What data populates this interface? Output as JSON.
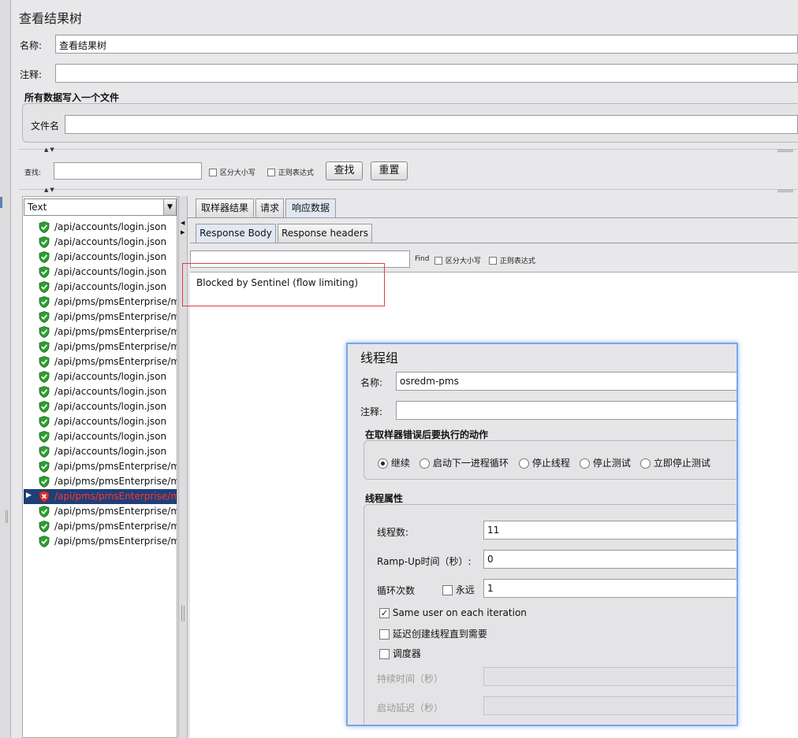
{
  "panel": {
    "title": "查看结果树",
    "name_label": "名称:",
    "name_value": "查看结果树",
    "comment_label": "注释:",
    "comment_value": "",
    "file_group_title": "所有数据写入一个文件",
    "file_label": "文件名",
    "file_value": ""
  },
  "search": {
    "label": "查找:",
    "value": "",
    "case_label": "区分大小写",
    "regex_label": "正则表达式",
    "find_button": "查找",
    "reset_button": "重置"
  },
  "renderer": {
    "selected": "Text"
  },
  "tree": {
    "items": [
      {
        "label": "/api/accounts/login.json",
        "status": "success"
      },
      {
        "label": "/api/accounts/login.json",
        "status": "success"
      },
      {
        "label": "/api/accounts/login.json",
        "status": "success"
      },
      {
        "label": "/api/accounts/login.json",
        "status": "success"
      },
      {
        "label": "/api/accounts/login.json",
        "status": "success"
      },
      {
        "label": "/api/pms/pmsEnterprise/myL",
        "status": "success"
      },
      {
        "label": "/api/pms/pmsEnterprise/myL",
        "status": "success"
      },
      {
        "label": "/api/pms/pmsEnterprise/myL",
        "status": "success"
      },
      {
        "label": "/api/pms/pmsEnterprise/myL",
        "status": "success"
      },
      {
        "label": "/api/pms/pmsEnterprise/myL",
        "status": "success"
      },
      {
        "label": "/api/accounts/login.json",
        "status": "success"
      },
      {
        "label": "/api/accounts/login.json",
        "status": "success"
      },
      {
        "label": "/api/accounts/login.json",
        "status": "success"
      },
      {
        "label": "/api/accounts/login.json",
        "status": "success"
      },
      {
        "label": "/api/accounts/login.json",
        "status": "success"
      },
      {
        "label": "/api/accounts/login.json",
        "status": "success"
      },
      {
        "label": "/api/pms/pmsEnterprise/myL",
        "status": "success"
      },
      {
        "label": "/api/pms/pmsEnterprise/myL",
        "status": "success"
      },
      {
        "label": "/api/pms/pmsEnterprise/myL",
        "status": "error",
        "selected": true
      },
      {
        "label": "/api/pms/pmsEnterprise/myL",
        "status": "success"
      },
      {
        "label": "/api/pms/pmsEnterprise/myL",
        "status": "success"
      },
      {
        "label": "/api/pms/pmsEnterprise/myL",
        "status": "success"
      }
    ]
  },
  "result_tabs": [
    "取样器结果",
    "请求",
    "响应数据"
  ],
  "response_tabs": [
    "Response Body",
    "Response headers"
  ],
  "response_search": {
    "find_label": "Find",
    "case_label": "区分大小写",
    "regex_label": "正则表达式"
  },
  "response_body": "Blocked by Sentinel (flow limiting)",
  "thread_group": {
    "title": "线程组",
    "name_label": "名称:",
    "name_value": "osredm-pms",
    "comment_label": "注释:",
    "comment_value": "",
    "error_action_title": "在取样器错误后要执行的动作",
    "actions": [
      "继续",
      "启动下一进程循环",
      "停止线程",
      "停止测试",
      "立即停止测试"
    ],
    "selected_action": "继续",
    "props_title": "线程属性",
    "threads_label": "线程数:",
    "threads_value": "11",
    "rampup_label": "Ramp-Up时间（秒）:",
    "rampup_value": "0",
    "loop_label": "循环次数",
    "forever_label": "永远",
    "loop_value": "1",
    "same_user_label": "Same user on each iteration",
    "delay_label": "延迟创建线程直到需要",
    "scheduler_label": "调度器",
    "duration_label": "持续时间（秒）",
    "startup_delay_label": "启动延迟（秒）"
  },
  "colors": {
    "accent": "#7aa6e8",
    "selection": "#1f3f78",
    "error_text": "#ff3333",
    "success_icon": "#2e9e2e",
    "highlight_box": "#e33d3d"
  }
}
